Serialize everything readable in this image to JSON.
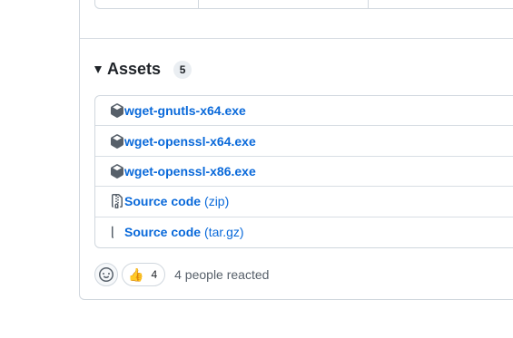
{
  "assets": {
    "title": "Assets",
    "count": "5",
    "items": [
      {
        "name": "wget-gnutls-x64.exe",
        "ext": "",
        "icon": "package-icon"
      },
      {
        "name": "wget-openssl-x64.exe",
        "ext": "",
        "icon": "package-icon"
      },
      {
        "name": "wget-openssl-x86.exe",
        "ext": "",
        "icon": "package-icon"
      },
      {
        "name": "Source code",
        "ext": "(zip)",
        "icon": "file-zip-icon"
      },
      {
        "name": "Source code",
        "ext": "(tar.gz)",
        "icon": "file-zip-icon"
      }
    ]
  },
  "reactions": {
    "thumbs_up_emoji": "👍",
    "thumbs_up_count": "4",
    "summary": "4 people reacted"
  },
  "colors": {
    "link": "#0969da",
    "border": "#d0d7de",
    "muted_text": "#57606a"
  }
}
